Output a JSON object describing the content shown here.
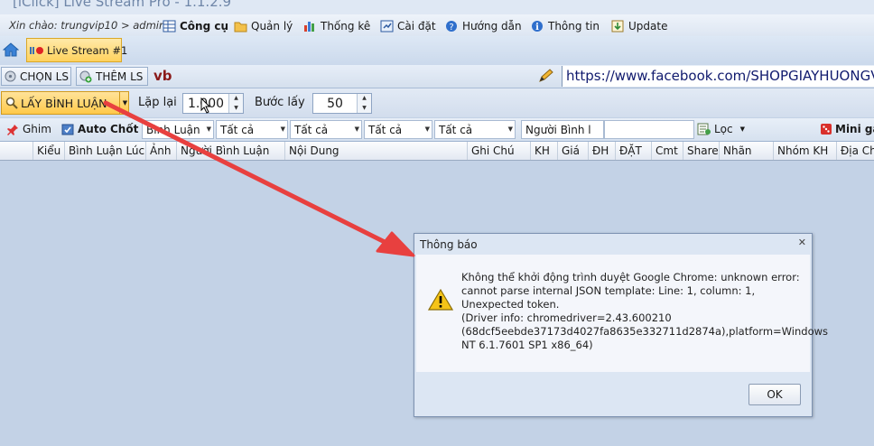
{
  "window": {
    "title": "[iClick] Live Stream Pro - 1.1.2.9"
  },
  "menubar": {
    "greeting": "Xin chào: trungvip10 > admin",
    "items": [
      {
        "label": "Công cụ",
        "icon": "grid-icon",
        "bold": true
      },
      {
        "label": "Quản lý",
        "icon": "folder-icon"
      },
      {
        "label": "Thống kê",
        "icon": "bar-chart-icon"
      },
      {
        "label": "Cài đặt",
        "icon": "settings-icon"
      },
      {
        "label": "Hướng dẫn",
        "icon": "help-icon"
      },
      {
        "label": "Thông tin",
        "icon": "info-icon"
      },
      {
        "label": "Update",
        "icon": "update-icon"
      }
    ]
  },
  "tabs": {
    "active_label": "Live Stream #1"
  },
  "row3": {
    "chon_ls": "CHỌN LS",
    "them_ls": "THÊM LS",
    "code": "vb",
    "url": "https://www.facebook.com/SHOPGIAYHUONGV"
  },
  "controls": {
    "lay_binh_luan": "LẤY BÌNH LUẬN",
    "lap_lai_label": "Lặp lại",
    "lap_lai_value": "1.000",
    "buoc_lay_label": "Bước lấy",
    "buoc_lay_value": "50"
  },
  "filterbar": {
    "ghim": "Ghim",
    "auto_chot": "Auto Chốt",
    "combo1": "Bình Luận",
    "combo2": "Tất cả",
    "combo3": "Tất cả",
    "combo4": "Tất cả",
    "combo5": "Tất cả",
    "nguoi_binh_luan": "Người Bình l",
    "loc": "Lọc",
    "mini_game": "Mini ga"
  },
  "grid": {
    "columns": [
      "Kiểu",
      "Bình Luận Lúc",
      "Ảnh",
      "Người Bình Luận",
      "Nội Dung",
      "Ghi Chú",
      "KH",
      "Giá",
      "ĐH",
      "ĐẶT",
      "Cmt",
      "Share",
      "Nhãn",
      "Nhóm KH",
      "Địa Chỉ"
    ]
  },
  "dialog": {
    "title": "Thông báo",
    "message": "Không thể khởi động trình duyệt Google Chrome: unknown error: cannot parse internal JSON template: Line: 1, column: 1, Unexpected token.\n  (Driver info: chromedriver=2.43.600210 (68dcf5eebde37173d4027fa8635e332711d2874a),platform=Windows NT 6.1.7601 SP1 x86_64)",
    "ok": "OK"
  },
  "colors": {
    "arrow": "#e8403f",
    "accent": "#ffc94a"
  }
}
